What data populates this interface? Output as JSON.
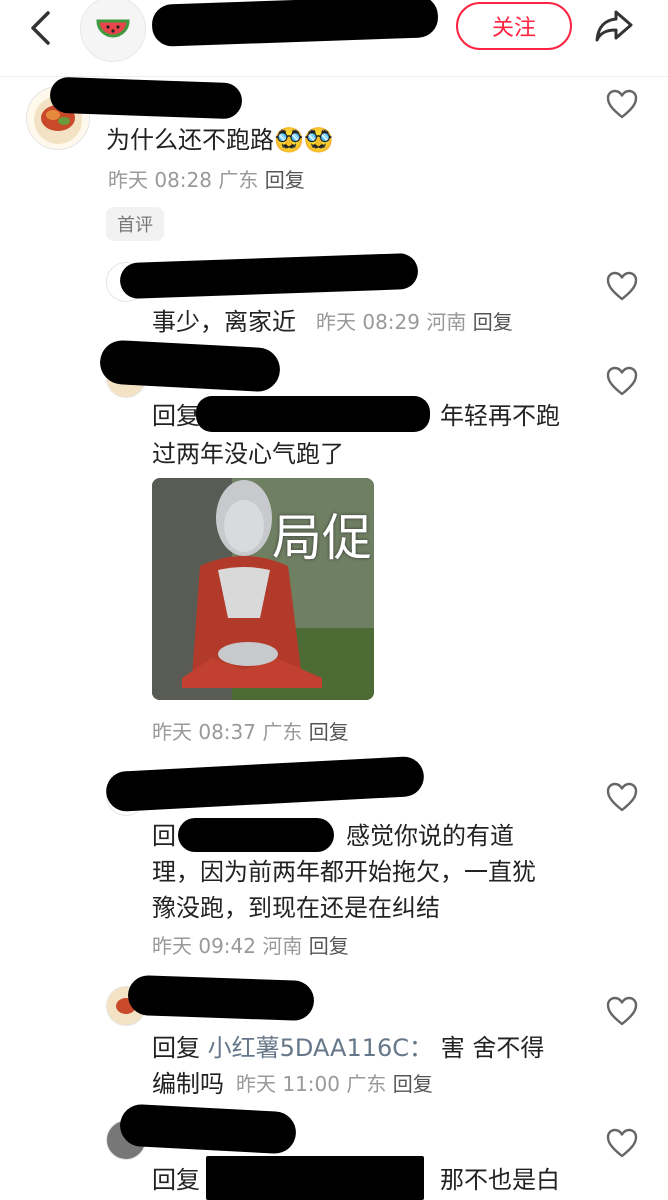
{
  "header": {
    "follow_label": "关注"
  },
  "comments": [
    {
      "text": "为什么还不跑路",
      "emoji": "🥸🥸",
      "time": "昨天 08:28",
      "location": "广东",
      "reply_label": "回复",
      "badge": "首评"
    },
    {
      "text": "事少，离家近",
      "time": "昨天 08:29",
      "location": "河南",
      "reply_label": "回复"
    },
    {
      "reply_prefix": "回复",
      "line1_tail": "年轻再不跑",
      "line2": "过两年没心气跑了",
      "sticker_text": "局促",
      "time": "昨天 08:37",
      "location": "广东",
      "reply_label": "回复"
    },
    {
      "reply_prefix": "回",
      "line1_tail": "感觉你说的有道",
      "line2": "理，因为前两年都开始拖欠，一直犹",
      "line3": "豫没跑，到现在还是在纠结",
      "time": "昨天 09:42",
      "location": "河南",
      "reply_label": "回复"
    },
    {
      "reply_prefix": "回复",
      "mention": "小红薯5DAA116C：",
      "line1_tail": "害 舍不得",
      "line2": "编制吗",
      "time": "昨天 11:00",
      "location": "广东",
      "reply_label": "回复"
    },
    {
      "reply_prefix": "回复",
      "line1_tail": "那不也是白"
    }
  ]
}
